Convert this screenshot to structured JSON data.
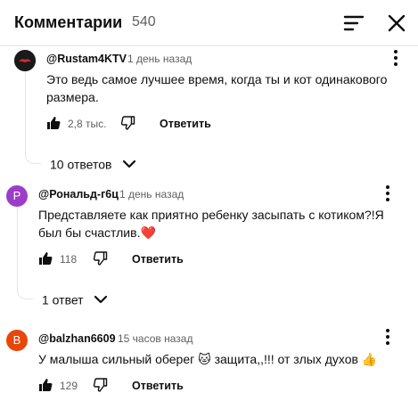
{
  "header": {
    "title": "Комментарии",
    "count": "540"
  },
  "comments": [
    {
      "author": "@Rustam4KTV",
      "time": "1 день назад",
      "text": "Это ведь самое лучшее время, когда ты и кот одинакового размера.",
      "likes": "2,8 тыс.",
      "reply_label": "Ответить",
      "replies_label": "10 ответов",
      "avatar_color": "#1a1a1a"
    },
    {
      "author": "@Рональд-г6ц",
      "avatar_letter": "Р",
      "time": "1 день назад",
      "text": "Представляете как приятно ребенку засыпать с котиком?!Я был бы счастлив.",
      "emoji": "❤️",
      "likes": "118",
      "reply_label": "Ответить",
      "replies_label": "1 ответ",
      "avatar_color": "#9c3dc7"
    },
    {
      "author": "@balzhan6609",
      "avatar_letter": "B",
      "time": "15 часов назад",
      "text": "У малыша сильный оберег 🐱 защита,,!!! от злых духов 👍",
      "likes": "129",
      "reply_label": "Ответить",
      "avatar_color": "#e8470a"
    }
  ]
}
